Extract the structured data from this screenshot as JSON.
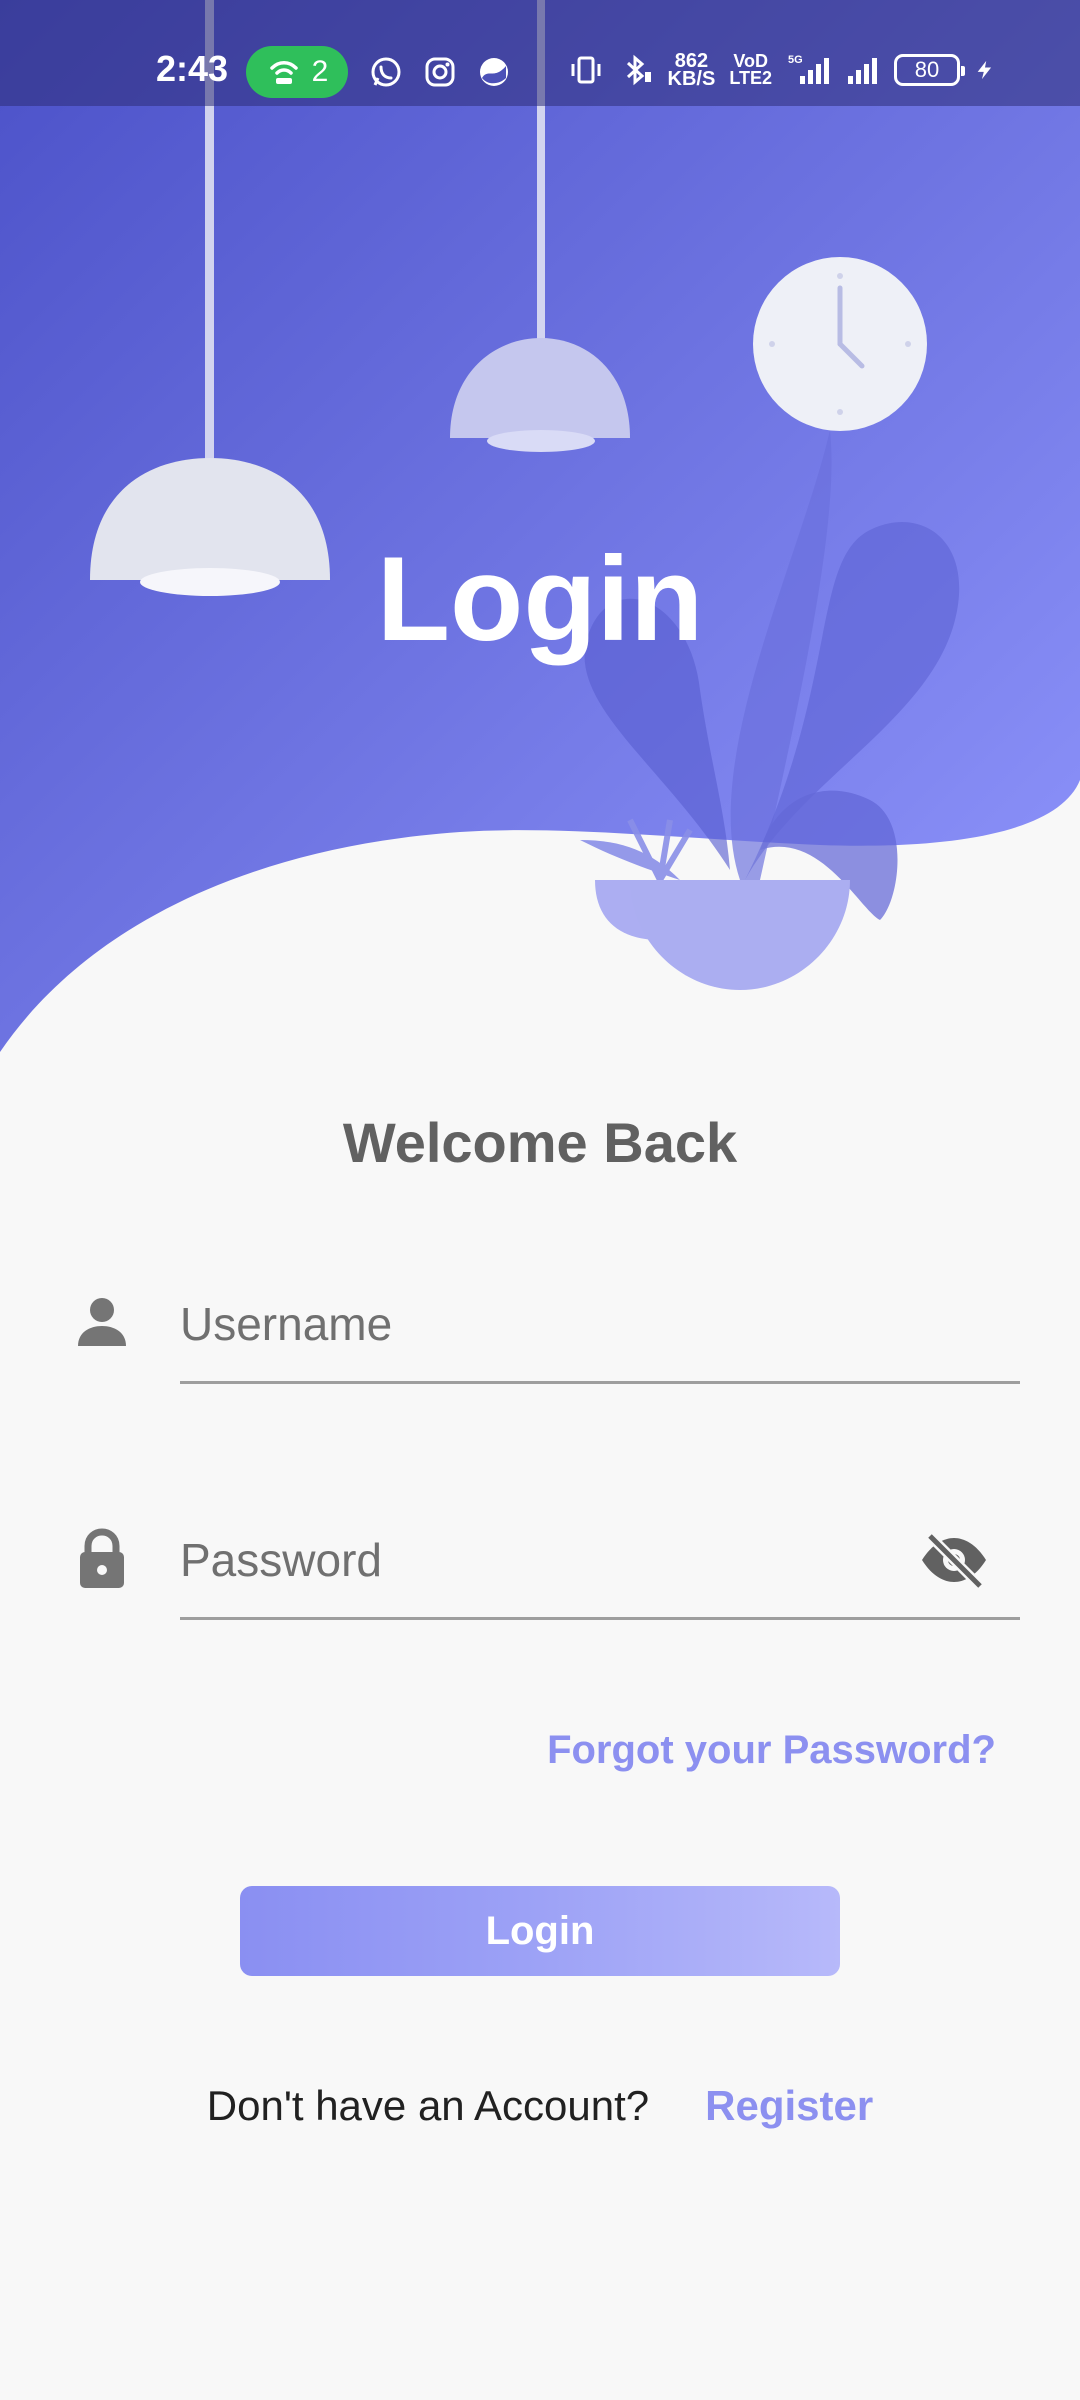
{
  "status_bar": {
    "time": "2:43",
    "hotspot_count": "2",
    "net_speed_value": "862",
    "net_speed_unit": "KB/S",
    "volte_top": "VoD",
    "volte_bottom": "LTE2",
    "network_type": "5G",
    "battery_level": "80"
  },
  "hero": {
    "title": "Login"
  },
  "form": {
    "welcome": "Welcome Back",
    "username_placeholder": "Username",
    "password_placeholder": "Password",
    "forgot_label": "Forgot your Password?",
    "login_label": "Login"
  },
  "footer": {
    "prompt": "Don't have an Account?",
    "register_label": "Register"
  },
  "colors": {
    "gradient_start": "#4f55c9",
    "gradient_end": "#8e94fb",
    "accent": "#8c90f0",
    "background": "#f8f8f8"
  }
}
